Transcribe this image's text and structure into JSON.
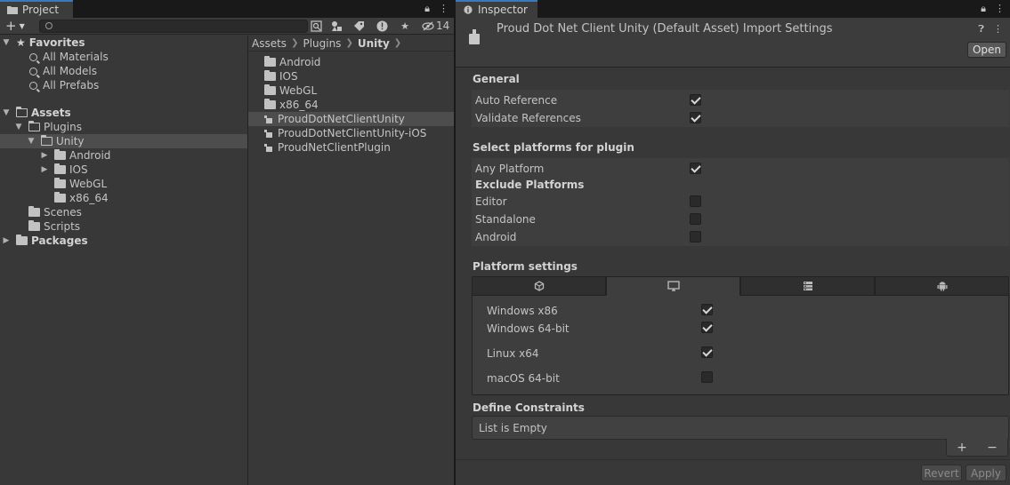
{
  "project": {
    "tab_label": "Project",
    "toolbar": {
      "add_label": "+",
      "hidden_count": "14"
    },
    "favorites": {
      "label": "Favorites",
      "items": [
        "All Materials",
        "All Models",
        "All Prefabs"
      ]
    },
    "tree": {
      "assets_label": "Assets",
      "plugins_label": "Plugins",
      "unity_label": "Unity",
      "unity_children": [
        "Android",
        "IOS",
        "WebGL",
        "x86_64"
      ],
      "scenes_label": "Scenes",
      "scripts_label": "Scripts",
      "packages_label": "Packages"
    },
    "breadcrumb": [
      "Assets",
      "Plugins",
      "Unity"
    ],
    "assets": {
      "folders": [
        "Android",
        "IOS",
        "WebGL",
        "x86_64"
      ],
      "plugins": [
        "ProudDotNetClientUnity",
        "ProudDotNetClientUnity-iOS",
        "ProudNetClientPlugin"
      ]
    }
  },
  "inspector": {
    "tab_label": "Inspector",
    "title": "Proud Dot Net Client Unity (Default Asset) Import Settings",
    "open_label": "Open",
    "general": {
      "title": "General",
      "auto_reference": {
        "label": "Auto Reference",
        "checked": true
      },
      "validate_references": {
        "label": "Validate References",
        "checked": true
      }
    },
    "select_platforms": {
      "title": "Select platforms for plugin",
      "any_platform": {
        "label": "Any Platform",
        "checked": true
      },
      "exclude_title": "Exclude Platforms",
      "exclude": [
        {
          "label": "Editor",
          "checked": false
        },
        {
          "label": "Standalone",
          "checked": false
        },
        {
          "label": "Android",
          "checked": false
        }
      ]
    },
    "platform_settings": {
      "title": "Platform settings",
      "tabs": [
        "unity-icon",
        "desktop-icon",
        "server-icon",
        "android-icon"
      ],
      "options": [
        {
          "label": "Windows x86",
          "checked": true
        },
        {
          "label": "Windows 64-bit",
          "checked": true
        },
        {
          "label": "Linux x64",
          "checked": true
        },
        {
          "label": "macOS 64-bit",
          "checked": false
        }
      ]
    },
    "define_constraints": {
      "title": "Define Constraints",
      "empty_label": "List is Empty",
      "add_label": "+",
      "remove_label": "−"
    },
    "revert_label": "Revert",
    "apply_label": "Apply"
  }
}
